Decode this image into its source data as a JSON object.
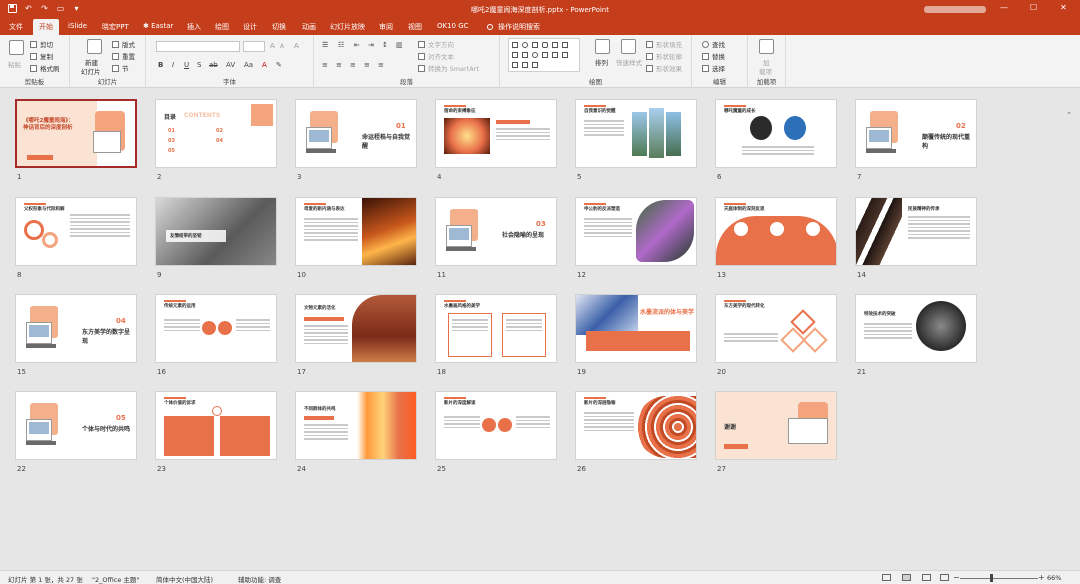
{
  "window": {
    "title": "哪吒2魔童闹海深度剖析.pptx  -  PowerPoint",
    "minimize": "—",
    "maximize": "☐",
    "close": "✕",
    "qat_icons": [
      "save-icon",
      "undo-icon",
      "redo-icon",
      "start-from-beginning-icon",
      "qat-customize-icon"
    ]
  },
  "tabs": [
    {
      "label": "文件"
    },
    {
      "label": "开始"
    },
    {
      "label": "iSlide"
    },
    {
      "label": "晓宏PPT"
    },
    {
      "label": "✱ Eastar"
    },
    {
      "label": "插入"
    },
    {
      "label": "绘图"
    },
    {
      "label": "设计"
    },
    {
      "label": "切换"
    },
    {
      "label": "动画"
    },
    {
      "label": "幻灯片放映"
    },
    {
      "label": "审阅"
    },
    {
      "label": "视图"
    },
    {
      "label": "OK10 GC"
    }
  ],
  "active_tab": "开始",
  "tell_me": "操作说明搜索",
  "ribbon": {
    "clipboard": {
      "title": "剪贴板",
      "paste": "粘贴",
      "cut": "剪切",
      "copy": "复制",
      "format_painter": "格式刷"
    },
    "slides": {
      "title": "幻灯片",
      "new_slide_line1": "新建",
      "new_slide_line2": "幻灯片",
      "layout": "版式",
      "reset": "重置",
      "section": "节"
    },
    "font": {
      "title": "字体"
    },
    "paragraph": {
      "title": "段落",
      "text_direction": "文字方向",
      "align_text": "对齐文本",
      "smartart": "转换为 SmartArt"
    },
    "drawing": {
      "title": "绘图",
      "arrange": "排列",
      "quick_styles": "快速样式",
      "shape_fill": "形状填充",
      "shape_outline": "形状轮廓",
      "shape_effects": "形状效果"
    },
    "editing": {
      "title": "编辑",
      "find": "查找",
      "replace": "替换",
      "select": "选择"
    },
    "addins": {
      "title": "加载项",
      "addins_line1": "加",
      "addins_line2": "载项"
    }
  },
  "slides": [
    {
      "n": "1",
      "title": "《哪吒2魔童闹海》：神话背后的深度剖析",
      "selected": true
    },
    {
      "n": "2",
      "title": "目录",
      "subtitle": "CONTENTS"
    },
    {
      "n": "3",
      "title": "命运桎梏与自我觉醒",
      "num": "01"
    },
    {
      "n": "4",
      "title": "宿命的束缚象征"
    },
    {
      "n": "5",
      "title": "自我意识的觉醒"
    },
    {
      "n": "6",
      "title": "哪吒魔童的成长"
    },
    {
      "n": "7",
      "title": "颠覆传统的现代重构",
      "num": "02"
    },
    {
      "n": "8",
      "title": "父权形象与代际和解"
    },
    {
      "n": "9",
      "title": "友情纽带的坚韧"
    },
    {
      "n": "10",
      "title": "母爱的新内涵与表达"
    },
    {
      "n": "11",
      "title": "社会隐喻的呈现",
      "num": "03"
    },
    {
      "n": "12",
      "title": "申公豹的反派塑造"
    },
    {
      "n": "13",
      "title": "天庭体制的深刻反思"
    },
    {
      "n": "14",
      "title": "民族精神的传承"
    },
    {
      "n": "15",
      "title": "东方美学的数字呈现",
      "num": "04"
    },
    {
      "n": "16",
      "title": "传统元素的运用"
    },
    {
      "n": "17",
      "title": "文物元素的活化"
    },
    {
      "n": "18",
      "title": "水墨画风格的美学"
    },
    {
      "n": "19",
      "title": "水墨流派的体与美学"
    },
    {
      "n": "20",
      "title": "东方美学的现代转化"
    },
    {
      "n": "21",
      "title": "特效技术的突破"
    },
    {
      "n": "22",
      "title": "个体与时代的共鸣",
      "num": "05"
    },
    {
      "n": "23",
      "title": "个体价值的诉求"
    },
    {
      "n": "24",
      "title": "不同群体的共鸣"
    },
    {
      "n": "25",
      "title": "影片的深度解读"
    },
    {
      "n": "26",
      "title": "影片的深层隐喻"
    },
    {
      "n": "27",
      "title": "谢谢"
    }
  ],
  "status": {
    "slide_count": "幻灯片 第 1 张，共 27 张",
    "theme": "\"2_Office 主题\"",
    "language": "简体中文(中国大陆)",
    "accessibility": "辅助功能: 调查",
    "zoom": "66%"
  }
}
